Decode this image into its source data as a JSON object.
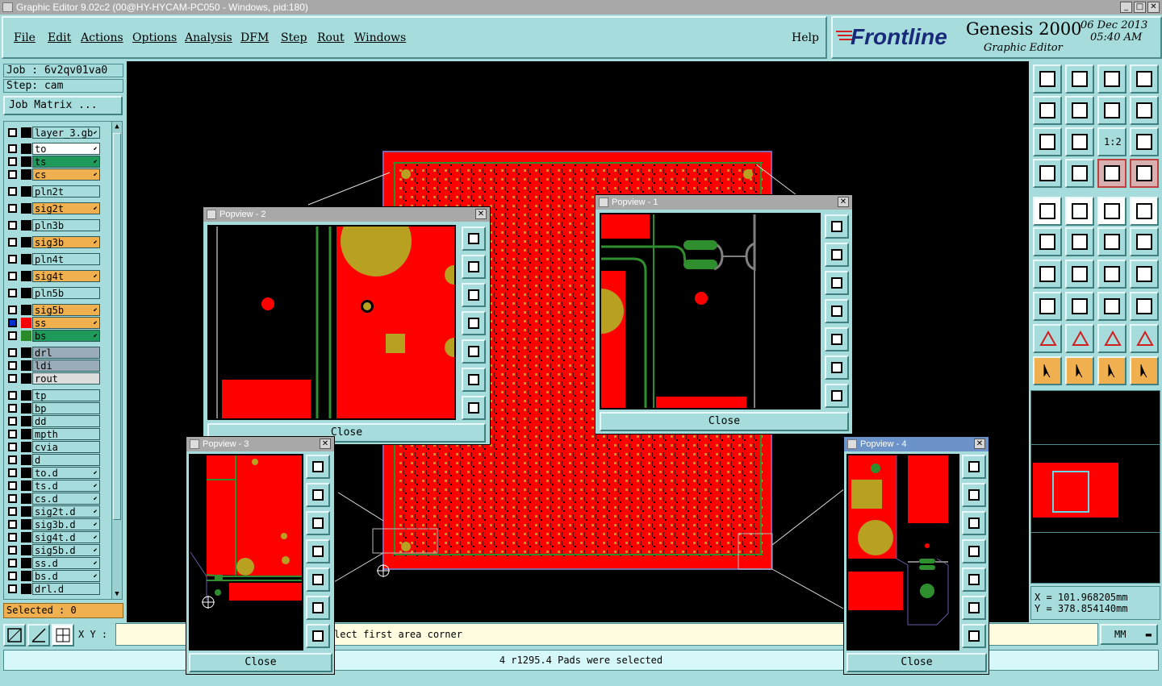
{
  "window": {
    "title": "Graphic Editor 9.02c2 (00@HY-HYCAM-PC050 - Windows, pid:180)"
  },
  "menu": [
    "File",
    "Edit",
    "Actions",
    "Options",
    "Analysis",
    "DFM",
    "Step",
    "Rout",
    "Windows"
  ],
  "help": "Help",
  "brand": {
    "logo": "Frontline",
    "product": "Genesis 2000",
    "subtitle": "Graphic Editor",
    "date": "06 Dec 2013",
    "time": "05:40 AM"
  },
  "job": {
    "label": "Job : 6v2qv01va0",
    "step": "Step: cam",
    "matrix_button": "Job Matrix ..."
  },
  "layers": [
    {
      "name": "layer_3.gb",
      "color": "#a6dcdc",
      "mark": "⬋"
    },
    {
      "name": "to",
      "color": "#ffffff",
      "mark": "⬋"
    },
    {
      "name": "ts",
      "color": "#1f9a5a",
      "mark": "⬋"
    },
    {
      "name": "cs",
      "color": "#f0b050",
      "mark": "⬋"
    },
    {
      "name": "pln2t",
      "color": "#a6dcdc",
      "mark": ""
    },
    {
      "name": "sig2t",
      "color": "#f0b050",
      "mark": "⬋"
    },
    {
      "name": "pln3b",
      "color": "#a6dcdc",
      "mark": ""
    },
    {
      "name": "sig3b",
      "color": "#f0b050",
      "mark": "⬋"
    },
    {
      "name": "pln4t",
      "color": "#a6dcdc",
      "mark": ""
    },
    {
      "name": "sig4t",
      "color": "#f0b050",
      "mark": "⬋"
    },
    {
      "name": "pln5b",
      "color": "#a6dcdc",
      "mark": ""
    },
    {
      "name": "sig5b",
      "color": "#f0b050",
      "mark": "⬋"
    },
    {
      "name": "ss",
      "color": "#f0b050",
      "mark": "⬋",
      "sw": "#ff0000",
      "active": true
    },
    {
      "name": "bs",
      "color": "#1f9a5a",
      "mark": "⬋",
      "sw": "#2a8a2a"
    },
    {
      "name": "drl",
      "color": "#9aacb8",
      "mark": ""
    },
    {
      "name": "ldi",
      "color": "#9aacb8",
      "mark": ""
    },
    {
      "name": "rout",
      "color": "#dcdcdc",
      "mark": ""
    },
    {
      "name": "tp",
      "color": "#a6dcdc",
      "mark": ""
    },
    {
      "name": "bp",
      "color": "#a6dcdc",
      "mark": ""
    },
    {
      "name": "dd",
      "color": "#a6dcdc",
      "mark": ""
    },
    {
      "name": "mpth",
      "color": "#a6dcdc",
      "mark": ""
    },
    {
      "name": "cvia",
      "color": "#a6dcdc",
      "mark": ""
    },
    {
      "name": "d",
      "color": "#a6dcdc",
      "mark": ""
    },
    {
      "name": "to.d",
      "color": "#a6dcdc",
      "mark": "⬋"
    },
    {
      "name": "ts.d",
      "color": "#a6dcdc",
      "mark": "⬋"
    },
    {
      "name": "cs.d",
      "color": "#a6dcdc",
      "mark": "⬋"
    },
    {
      "name": "sig2t.d",
      "color": "#a6dcdc",
      "mark": "⬋"
    },
    {
      "name": "sig3b.d",
      "color": "#a6dcdc",
      "mark": "⬋"
    },
    {
      "name": "sig4t.d",
      "color": "#a6dcdc",
      "mark": "⬋"
    },
    {
      "name": "sig5b.d",
      "color": "#a6dcdc",
      "mark": "⬋"
    },
    {
      "name": "ss.d",
      "color": "#a6dcdc",
      "mark": "⬋"
    },
    {
      "name": "bs.d",
      "color": "#a6dcdc",
      "mark": "⬋"
    },
    {
      "name": "drl.d",
      "color": "#a6dcdc",
      "mark": ""
    }
  ],
  "selected": "Selected : 0",
  "xy_label": "X Y :",
  "message": "lect first area corner",
  "status": "4 r1295.4 Pads were selected",
  "units": "MM",
  "coords": {
    "x": "X  =  101.968205mm",
    "y": "Y  =  378.854140mm"
  },
  "popviews": [
    {
      "title": "Popview - 2",
      "close": "Close"
    },
    {
      "title": "Popview - 1",
      "close": "Close"
    },
    {
      "title": "Popview - 3",
      "close": "Close"
    },
    {
      "title": "Popview - 4",
      "close": "Close"
    }
  ],
  "toolbar_zoom": [
    "1:2"
  ],
  "colors": {
    "board": "#ff0000",
    "pad": "#b8a020",
    "trace": "#2f8f2f",
    "ui": "#a6dcdc",
    "accent_orange": "#f0b050"
  }
}
